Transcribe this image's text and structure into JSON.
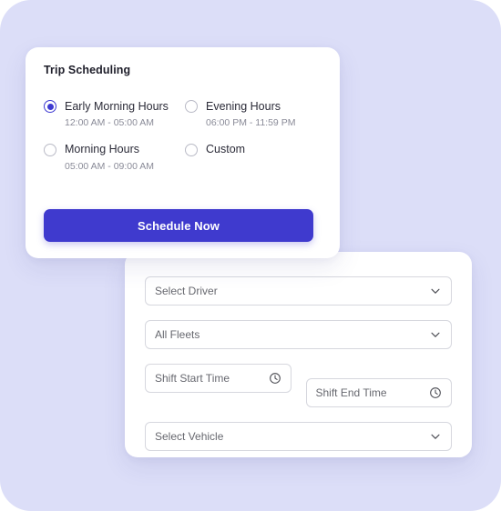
{
  "theme": {
    "page_background": "#ffffff",
    "backdrop": "#dcdef8",
    "card_background": "#ffffff",
    "accent": "#3f3ace",
    "radio_selected": "#3e3ad1",
    "radio_unselected_border": "#b9bac6",
    "field_border": "#d6d7de",
    "title_text": "#1d1d29",
    "label_text": "#2b2b38",
    "muted_text": "#8a8b98",
    "placeholder_text": "#67686f",
    "button_text": "#ffffff"
  },
  "scheduling_card": {
    "title": "Trip Scheduling",
    "options": [
      {
        "label": "Early Morning Hours",
        "time_range": "12:00 AM - 05:00 AM",
        "selected": true
      },
      {
        "label": "Evening Hours",
        "time_range": "06:00 PM - 11:59 PM",
        "selected": false
      },
      {
        "label": "Morning Hours",
        "time_range": "05:00 AM - 09:00 AM",
        "selected": false
      },
      {
        "label": "Custom",
        "time_range": "",
        "selected": false
      }
    ],
    "primary_button": {
      "label": "Schedule Now"
    }
  },
  "filters_card": {
    "fields": [
      {
        "name": "select-driver",
        "value": "Select Driver",
        "icon": "chevron-down-icon",
        "control": "select"
      },
      {
        "name": "all-fleets",
        "value": "All Fleets",
        "icon": "chevron-down-icon",
        "control": "select"
      },
      {
        "name": "shift-start-time",
        "value": "Shift Start Time",
        "icon": "clock-icon",
        "control": "time"
      },
      {
        "name": "shift-end-time",
        "value": "Shift End Time",
        "icon": "clock-icon",
        "control": "time"
      },
      {
        "name": "select-vehicle",
        "value": "Select Vehicle",
        "icon": "chevron-down-icon",
        "control": "select"
      }
    ]
  }
}
